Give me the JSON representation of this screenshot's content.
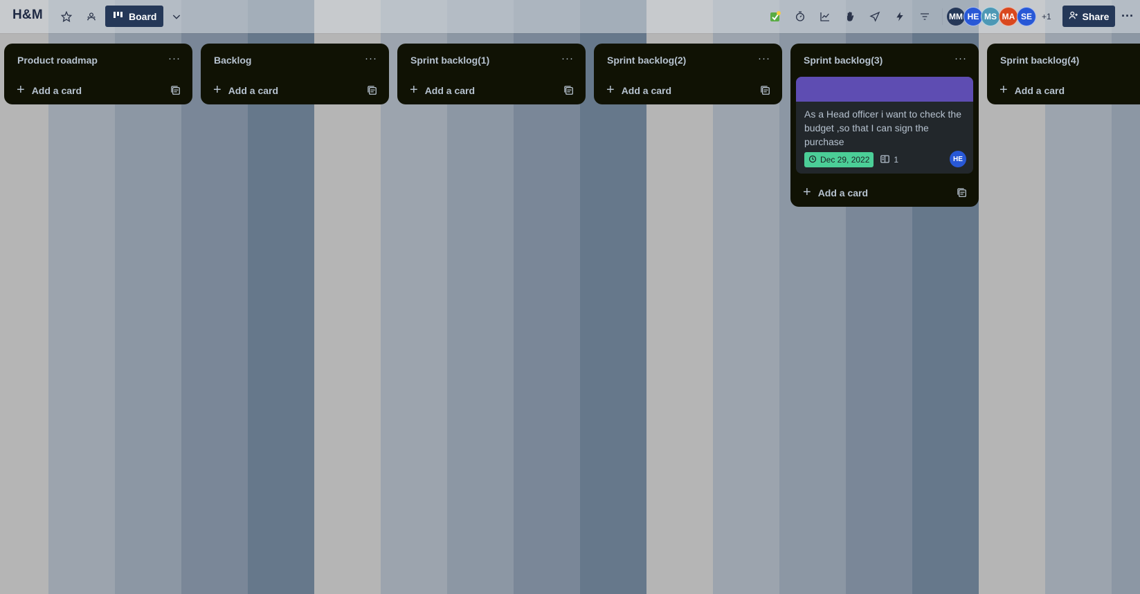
{
  "board": {
    "title": "H&M",
    "view_label": "Board"
  },
  "toolbar": {
    "share_label": "Share",
    "more_label": "···",
    "extra_members": "+1"
  },
  "members": [
    {
      "initials": "MM",
      "color": "#253858"
    },
    {
      "initials": "HE",
      "color": "#2858d6"
    },
    {
      "initials": "MS",
      "color": "#4d98b5"
    },
    {
      "initials": "MA",
      "color": "#d9481e"
    },
    {
      "initials": "SE",
      "color": "#2858d6"
    }
  ],
  "lists": [
    {
      "title": "Product roadmap",
      "add_label": "Add a card"
    },
    {
      "title": "Backlog",
      "add_label": "Add a card"
    },
    {
      "title": "Sprint backlog(1)",
      "add_label": "Add a card"
    },
    {
      "title": "Sprint backlog(2)",
      "add_label": "Add a card"
    },
    {
      "title": "Sprint backlog(3)",
      "add_label": "Add a card",
      "card": {
        "text": "As a Head officer i want to check the budget ,so that I can sign the purchase",
        "due_date": "Dec 29, 2022",
        "attachments": "1",
        "member": "HE",
        "cover_color": "#5e4db2"
      }
    },
    {
      "title": "Sprint backlog(4)",
      "add_label": "Add a card"
    }
  ],
  "list_menu_label": "···",
  "colors": {
    "list_bg": "#101204",
    "card_bg": "#22272b",
    "date_badge": "#4bce97",
    "header_button": "#253858"
  }
}
